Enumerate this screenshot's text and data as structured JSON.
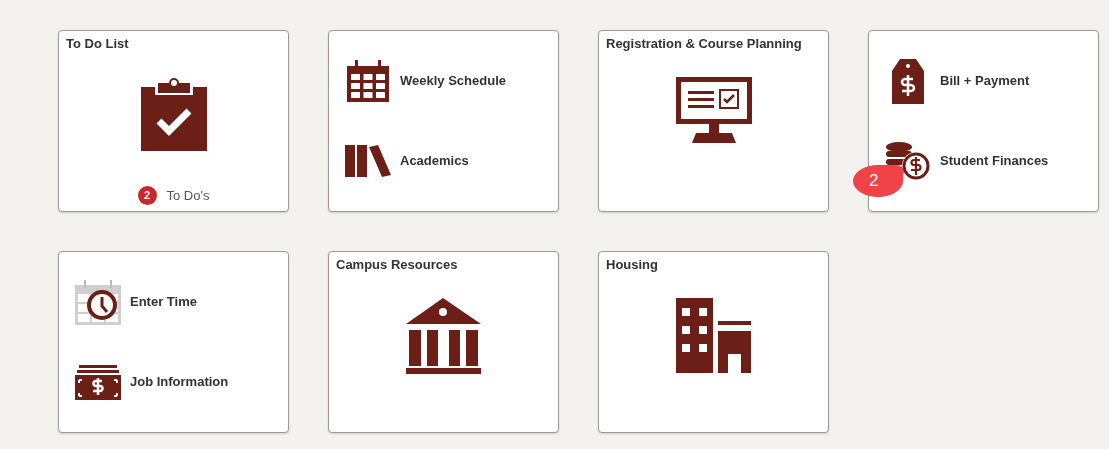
{
  "tiles": [
    {
      "kind": "single",
      "title": "To Do List",
      "footer": {
        "count": "2",
        "label": "To Do's"
      }
    },
    {
      "kind": "double",
      "links": [
        {
          "label": "Weekly Schedule"
        },
        {
          "label": "Academics"
        }
      ]
    },
    {
      "kind": "single",
      "title": "Registration & Course Planning"
    },
    {
      "kind": "double",
      "links": [
        {
          "label": "Bill + Payment"
        },
        {
          "label": "Student Finances",
          "notification": "2"
        }
      ]
    },
    {
      "kind": "double",
      "links": [
        {
          "label": "Enter Time"
        },
        {
          "label": "Job Information"
        }
      ]
    },
    {
      "kind": "single",
      "title": "Campus Resources"
    },
    {
      "kind": "single",
      "title": "Housing"
    }
  ]
}
